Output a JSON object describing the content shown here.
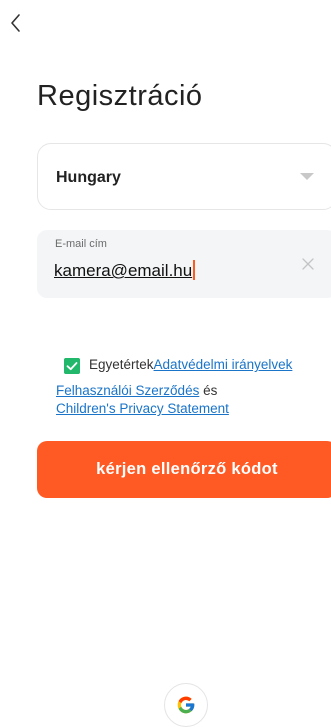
{
  "header": {
    "back_icon": "chevron-left-icon"
  },
  "page": {
    "title": "Regisztráció"
  },
  "country": {
    "selected": "Hungary",
    "icon": "caret-down-icon"
  },
  "email": {
    "label": "E-mail cím",
    "value": "kamera@email.hu",
    "clear_icon": "close-icon"
  },
  "agreement": {
    "checked": true,
    "prefix": "Egyetértek",
    "privacy_link": "Adatvédelmi irányelvek",
    "terms_link": "Felhasználói Szerződés",
    "conjunction": " és",
    "children_link": "Children's Privacy Statement",
    "check_color": "#22b86b",
    "link_color": "#1a74c8"
  },
  "submit": {
    "label": "kérjen ellenőrző kódot",
    "color": "#ff5a24"
  },
  "social": {
    "google_icon": "google-icon"
  }
}
